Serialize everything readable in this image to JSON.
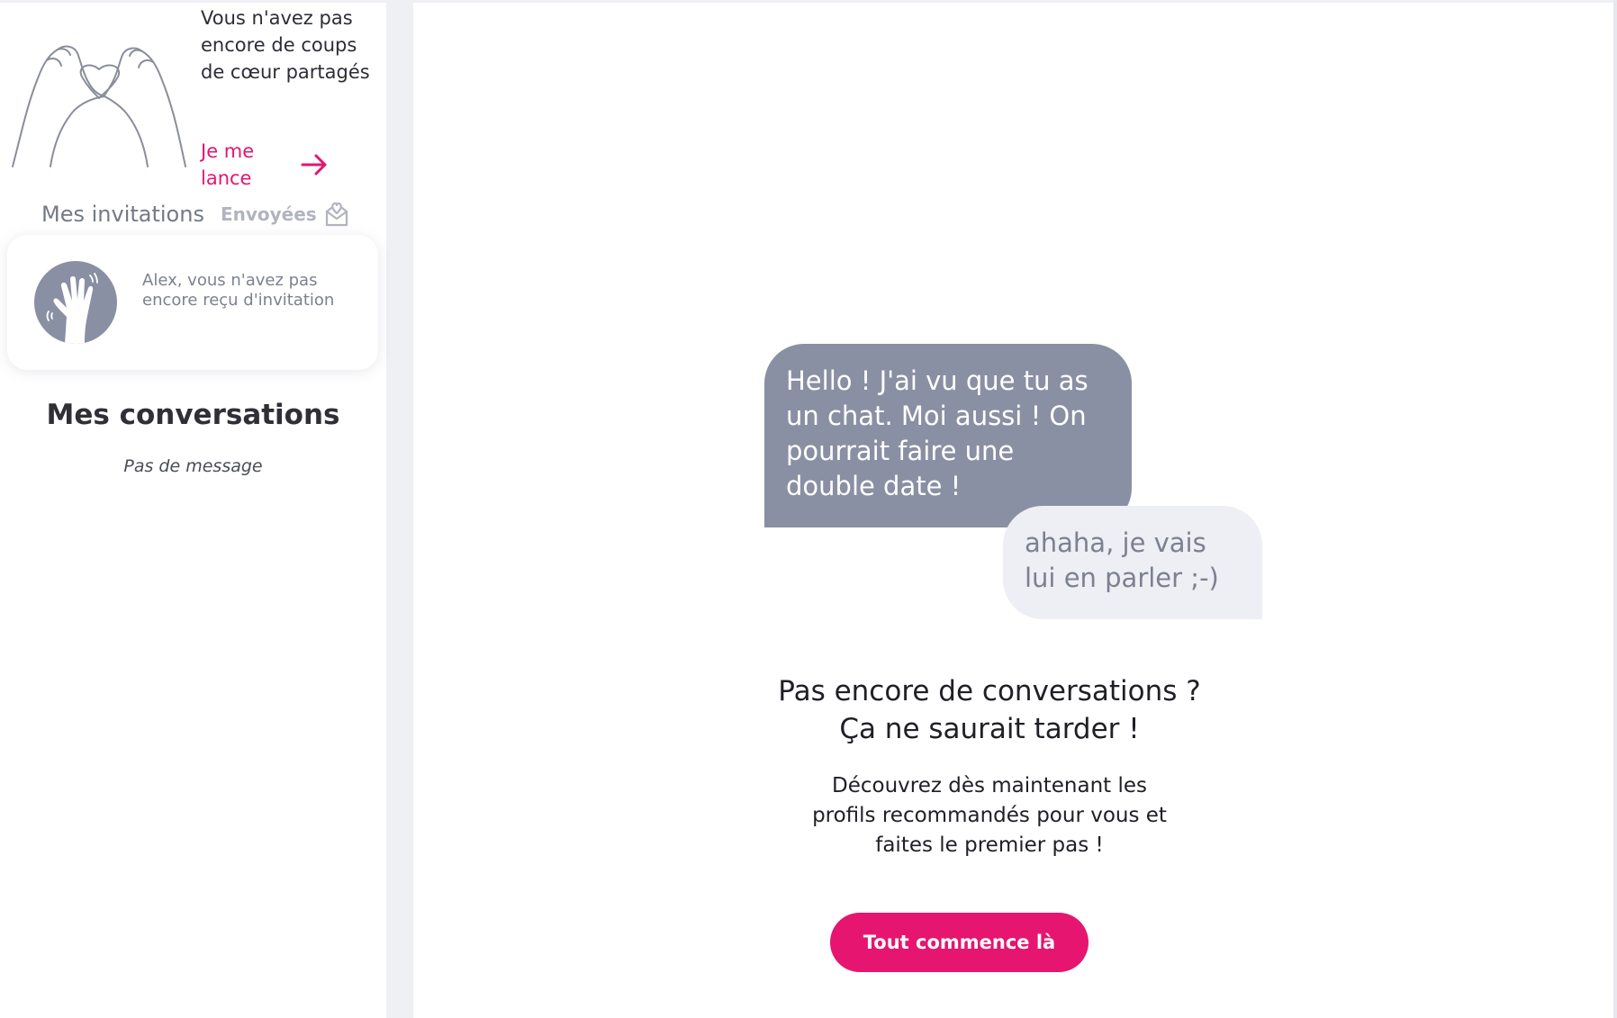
{
  "sidebar": {
    "hearts": {
      "empty_text": "Vous n'avez pas encore de coups de cœur partagés",
      "cta_label": "Je me lance"
    },
    "invitations": {
      "title": "Mes invitations",
      "sent_label": "Envoyées",
      "empty_text": "Alex, vous n'avez pas encore reçu d'invitation"
    },
    "conversations": {
      "title": "Mes conversations",
      "empty_text": "Pas de message"
    }
  },
  "main": {
    "sample_bubbles": [
      "Hello ! J'ai vu que tu as un chat. Moi aussi ! On pourrait faire une double date !",
      "ahaha, je vais lui en parler ;-)"
    ],
    "empty_title_line1": "Pas encore de conversations ?",
    "empty_title_line2": "Ça ne saurait tarder !",
    "empty_subtitle": "Découvrez dès maintenant les profils recommandés pour vous et faites le premier pas !",
    "cta_label": "Tout commence là"
  },
  "colors": {
    "accent": "#e6156f",
    "bubble_grey": "#8a90a3",
    "bubble_light": "#eeeff4",
    "page_bg": "#eef0f4"
  },
  "icons": [
    "heart-hands-illustration",
    "arrow-right-icon",
    "envelope-heart-icon",
    "waving-hand-icon"
  ]
}
